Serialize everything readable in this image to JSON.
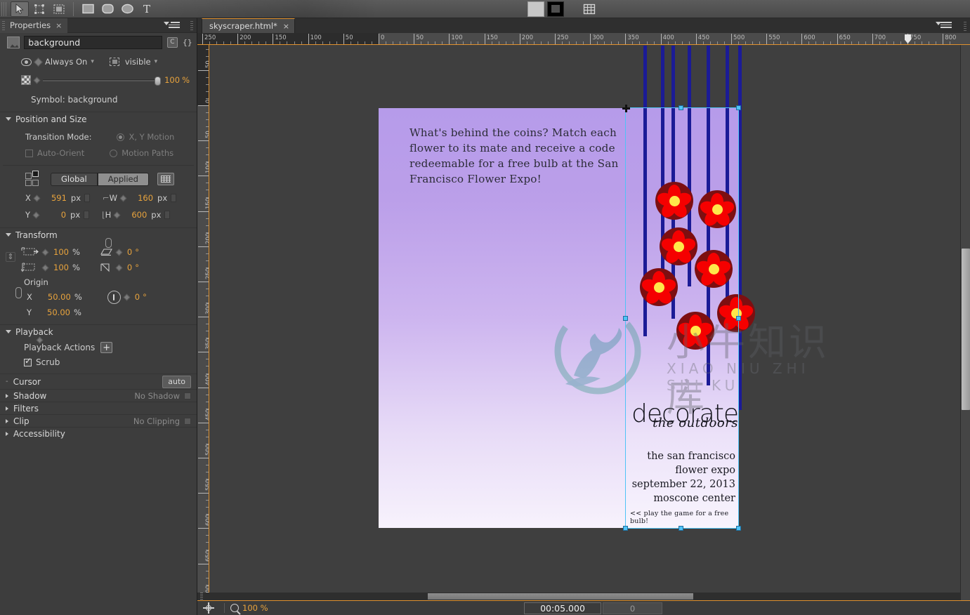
{
  "toolbar": {
    "tools": [
      {
        "name": "selection-tool",
        "icon": "arrow-cursor-icon",
        "selected": true
      },
      {
        "name": "transform-tool",
        "icon": "transform-box-icon",
        "selected": false
      },
      {
        "name": "marquee-tool",
        "icon": "marquee-select-icon",
        "selected": false
      },
      {
        "name": "rectangle-tool",
        "icon": "rectangle-icon",
        "selected": false
      },
      {
        "name": "rounded-rect-tool",
        "icon": "rounded-rectangle-icon",
        "selected": false
      },
      {
        "name": "ellipse-tool",
        "icon": "ellipse-icon",
        "selected": false
      },
      {
        "name": "text-tool",
        "icon": "text-t-icon",
        "selected": false
      }
    ],
    "fill_swatch_color": "#c7c7c7",
    "stroke_swatch_color": "#000000",
    "grid_button": "grid-table-icon"
  },
  "properties_panel": {
    "tab_label": "Properties",
    "tab_close": "×",
    "element_name_value": "background",
    "element_name_placeholder": "",
    "visibility": {
      "always_on_label": "Always On",
      "visible_label": "visible"
    },
    "opacity": {
      "value": "100",
      "unit": "%"
    },
    "symbol_label": "Symbol: background",
    "sections": {
      "position_and_size": {
        "title": "Position and Size",
        "transition_mode_label": "Transition Mode:",
        "xy_motion_label": "X, Y Motion",
        "auto_orient_label": "Auto-Orient",
        "motion_paths_label": "Motion Paths",
        "global_label": "Global",
        "applied_label": "Applied",
        "x_label": "X",
        "x_value": "591",
        "x_unit": "px",
        "y_label": "Y",
        "y_value": "0",
        "y_unit": "px",
        "w_label": "W",
        "w_value": "160",
        "w_unit": "px",
        "h_label": "H",
        "h_value": "600",
        "h_unit": "px"
      },
      "transform": {
        "title": "Transform",
        "scale_x_value": "100",
        "scale_x_unit": "%",
        "scale_y_value": "100",
        "scale_y_unit": "%",
        "skew_x_value": "0",
        "skew_x_unit": "°",
        "skew_y_value": "0",
        "skew_y_unit": "°",
        "origin_label": "Origin",
        "origin_x_label": "X",
        "origin_x_value": "50.00",
        "origin_x_unit": "%",
        "origin_y_label": "Y",
        "origin_y_value": "50.00",
        "origin_y_unit": "%",
        "rotation_value": "0",
        "rotation_unit": "°"
      },
      "playback": {
        "title": "Playback",
        "playback_actions_label": "Playback Actions",
        "add_button": "+",
        "scrub_label": "Scrub",
        "scrub_checked": true
      },
      "cursor": {
        "title": "Cursor",
        "value": "auto"
      },
      "shadow": {
        "title": "Shadow",
        "value": "No Shadow"
      },
      "filters": {
        "title": "Filters",
        "value": ""
      },
      "clip": {
        "title": "Clip",
        "value": "No Clipping"
      },
      "accessibility": {
        "title": "Accessibility",
        "value": ""
      }
    }
  },
  "document": {
    "tab_label": "skyscraper.html*",
    "tab_close": "×"
  },
  "rulers": {
    "horizontal_labels": [
      "250",
      "200",
      "150",
      "100",
      "50",
      "0",
      "50",
      "100",
      "150",
      "200",
      "250",
      "300",
      "350",
      "400",
      "450",
      "500",
      "550",
      "600",
      "650",
      "700",
      "750",
      "800"
    ],
    "vertical_labels": [
      "50",
      "0",
      "50",
      "100",
      "150",
      "200",
      "250",
      "300",
      "350",
      "400",
      "450",
      "500",
      "550",
      "600",
      "650",
      "700"
    ],
    "playhead_position_label": "750"
  },
  "stage": {
    "main_banner_text": "What's behind the coins? Match each flower to its mate and receive a code redeemable for a free bulb at the San Francisco Flower Expo!",
    "skyscraper": {
      "brand_primary": "decorate",
      "brand_secondary": "the outdoors",
      "info_lines": [
        "the san francisco",
        "flower expo",
        "september 22, 2013",
        "moscone center"
      ],
      "footer_link": "<< play the game for a free bulb!",
      "flower_petal_color": "#f50000",
      "flower_disc_color": "#7d0f11",
      "flower_center_color": "#ffe84a",
      "string_color": "#1b1b96",
      "background_gradient_top": "#b69bea",
      "background_gradient_bottom": "#f8f4fd"
    },
    "selection": {
      "accent_color": "#4fc3f7"
    }
  },
  "watermark": {
    "chinese": "小牛知识库",
    "pinyin": "XIAO NIU ZHI SHI KU"
  },
  "statusbar": {
    "zoom_value": "100 %",
    "time_value": "00:05.000",
    "frame_value": "0"
  }
}
